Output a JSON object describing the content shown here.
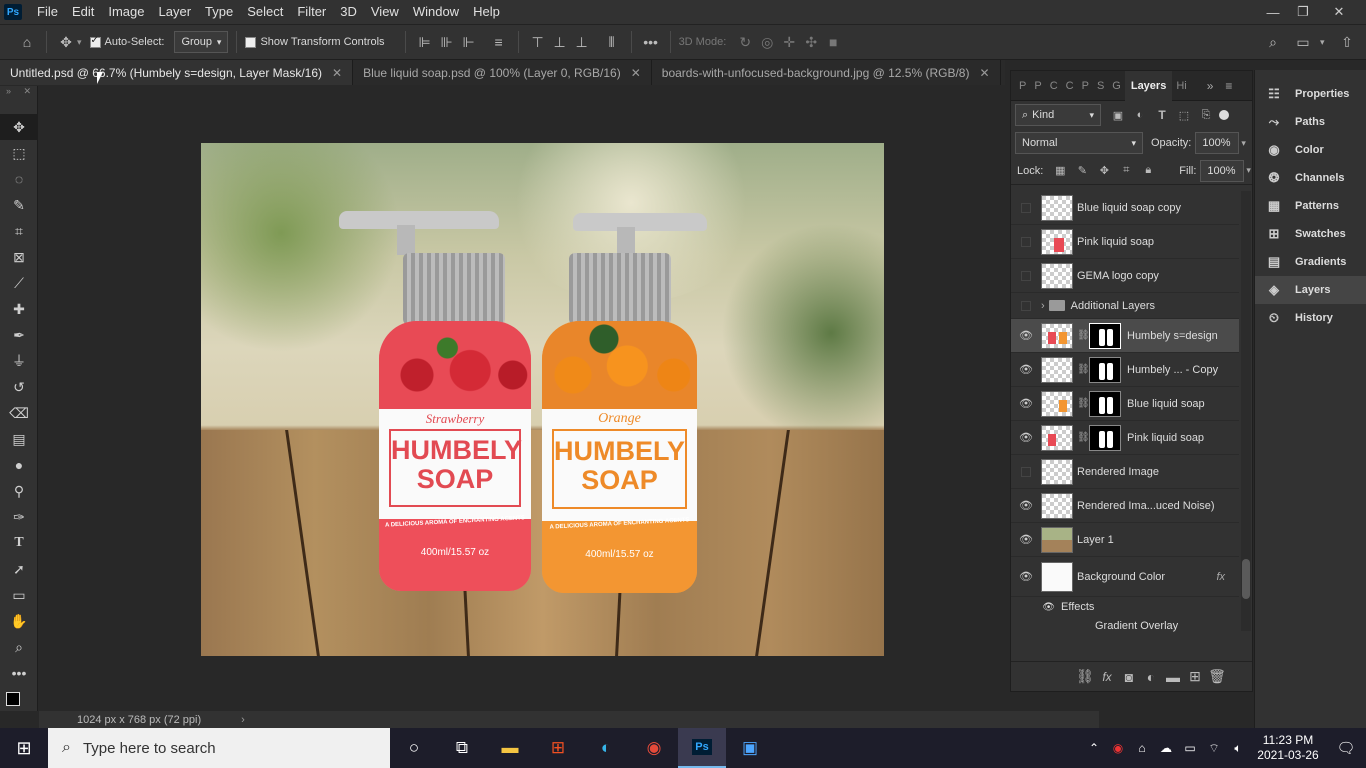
{
  "menubar": {
    "logo": "Ps",
    "items": [
      "File",
      "Edit",
      "Image",
      "Layer",
      "Type",
      "Select",
      "Filter",
      "3D",
      "View",
      "Window",
      "Help"
    ]
  },
  "options": {
    "auto_select_label": "Auto-Select:",
    "auto_select_value": "Group",
    "show_transform_label": "Show Transform Controls",
    "three_d_mode_label": "3D Mode:"
  },
  "tabs": [
    {
      "label": "Untitled.psd @ 66.7% (Humbely s=design, Layer Mask/16)"
    },
    {
      "label": "Blue liquid soap.psd @ 100% (Layer 0, RGB/16)"
    },
    {
      "label": "boards-with-unfocused-background.jpg @ 12.5% (RGB/8)"
    }
  ],
  "canvas": {
    "left_label_top": "Strawberry",
    "left_title": "HUMBELY",
    "left_title2": "SOAP",
    "left_tagline": "A DELICIOUS AROMA OF ENCHANTING ACENTS",
    "left_volume": "400ml/15.57 oz",
    "right_label_top": "Orange",
    "right_title": "HUMBELY",
    "right_title2": "SOAP",
    "right_tagline": "A DELICIOUS AROMA OF ENCHANTING ACENTS",
    "right_volume": "400ml/15.57 oz"
  },
  "status": {
    "doc_size": "1024 px x 768 px (72 ppi)"
  },
  "layers_panel": {
    "tabs": [
      "P",
      "P",
      "C",
      "C",
      "P",
      "S",
      "G",
      "Layers",
      "Hi"
    ],
    "filter_kind": "Kind",
    "blend_mode": "Normal",
    "opacity_label": "Opacity:",
    "opacity_value": "100%",
    "lock_label": "Lock:",
    "fill_label": "Fill:",
    "fill_value": "100%",
    "layers": [
      {
        "name": "Blue liquid soap copy",
        "visible": false
      },
      {
        "name": "Pink liquid soap",
        "visible": false
      },
      {
        "name": "GEMA logo copy",
        "visible": false
      },
      {
        "name": "Additional Layers",
        "visible": false
      },
      {
        "name": "Humbely s=design",
        "visible": true
      },
      {
        "name": "Humbely ... - Copy",
        "visible": true
      },
      {
        "name": "Blue liquid soap",
        "visible": true
      },
      {
        "name": "Pink liquid soap",
        "visible": true
      },
      {
        "name": "Rendered Image",
        "visible": false
      },
      {
        "name": "Rendered Ima...uced Noise)",
        "visible": true
      },
      {
        "name": "Layer 1",
        "visible": true
      },
      {
        "name": "Background Color",
        "visible": true
      }
    ],
    "effects_label": "Effects",
    "gradient_overlay_label": "Gradient Overlay"
  },
  "right_dock": [
    "Properties",
    "Paths",
    "Color",
    "Channels",
    "Patterns",
    "Swatches",
    "Gradients",
    "Layers",
    "History"
  ],
  "taskbar": {
    "search_placeholder": "Type here to search",
    "time": "11:23 PM",
    "date": "2021-03-26"
  }
}
